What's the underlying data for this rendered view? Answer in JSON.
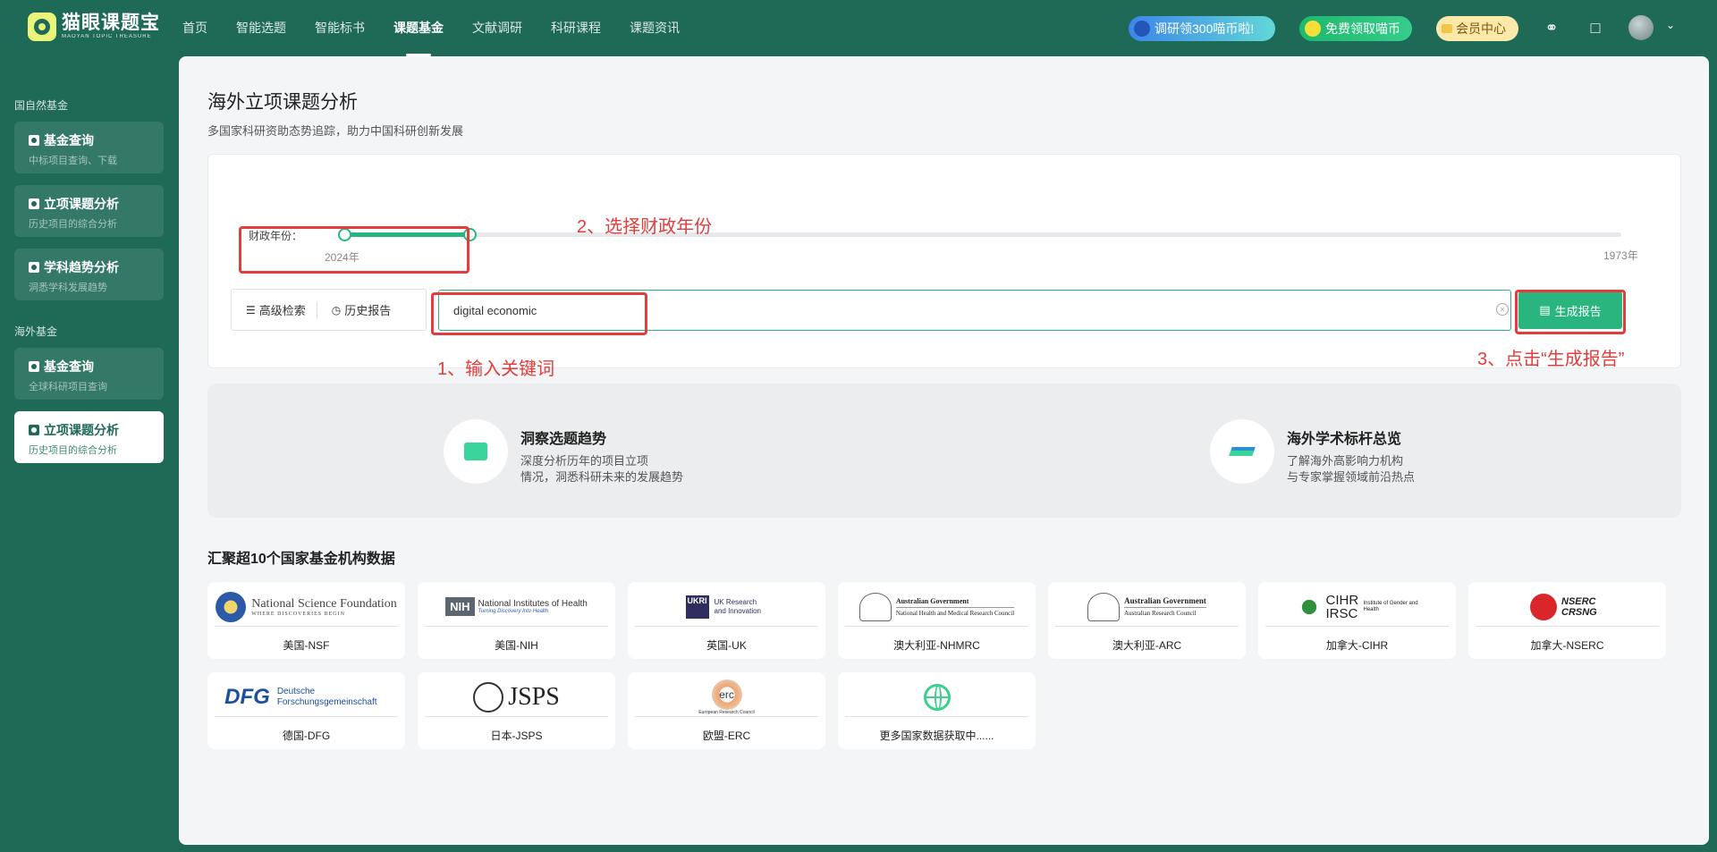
{
  "app": {
    "logo_cn": "猫眼课题宝",
    "logo_en": "MAOYAN TOPIC TREASURE"
  },
  "nav": {
    "items": [
      "首页",
      "智能选题",
      "智能标书",
      "课题基金",
      "文献调研",
      "科研课程",
      "课题资讯"
    ],
    "active_index": 3
  },
  "promos": {
    "p1": "调研领300喵币啦!",
    "p2": "免费领取喵币",
    "p3": "会员中心"
  },
  "sidebar": {
    "group1": "国自然基金",
    "group2": "海外基金",
    "items": [
      {
        "title": "基金查询",
        "sub": "中标项目查询、下载"
      },
      {
        "title": "立项课题分析",
        "sub": "历史项目的综合分析"
      },
      {
        "title": "学科趋势分析",
        "sub": "洞悉学科发展趋势"
      },
      {
        "title": "基金查询",
        "sub": "全球科研项目查询"
      },
      {
        "title": "立项课题分析",
        "sub": "历史项目的综合分析",
        "active": true
      }
    ]
  },
  "page": {
    "title": "海外立项课题分析",
    "subtitle": "多国家科研资助态势追踪，助力中国科研创新发展"
  },
  "filter": {
    "year_label": "财政年份：",
    "year_left": "2024年",
    "year_right": "1973年"
  },
  "toolbar": {
    "advanced": "高级检索",
    "history": "历史报告"
  },
  "search": {
    "value": "digital economic",
    "generate": "生成报告"
  },
  "annotations": {
    "a1": "1、输入关键词",
    "a2": "2、选择财政年份",
    "a3": "3、点击“生成报告”"
  },
  "features": [
    {
      "title": "洞察选题趋势",
      "line1": "深度分析历年的项目立项",
      "line2": "情况，洞悉科研未来的发展趋势"
    },
    {
      "title": "海外学术标杆总览",
      "line1": "了解海外高影响力机构",
      "line2": "与专家掌握领域前沿热点"
    }
  ],
  "institutions_title": "汇聚超10个国家基金机构数据",
  "institutions": [
    {
      "caption": "美国-NSF",
      "logo": "National Science Foundation",
      "logo_sub": "WHERE DISCOVERIES BEGIN"
    },
    {
      "caption": "美国-NIH",
      "logo": "National Institutes of Health",
      "logo_sub": "Turning Discovery Into Health",
      "badge": "NIH"
    },
    {
      "caption": "英国-UK",
      "logo": "UK Research and Innovation",
      "badge": "UKRI"
    },
    {
      "caption": "澳大利亚-NHMRC",
      "logo": "Australian Government",
      "logo_sub": "National Health and Medical Research Council"
    },
    {
      "caption": "澳大利亚-ARC",
      "logo": "Australian Government",
      "logo_sub": "Australian Research Council"
    },
    {
      "caption": "加拿大-CIHR",
      "logo": "CIHR IRSC",
      "logo_sub": "Institute of Gender and Health"
    },
    {
      "caption": "加拿大-NSERC",
      "logo": "NSERC CRSNG"
    },
    {
      "caption": "德国-DFG",
      "logo": "DFG",
      "logo_sub": "Deutsche Forschungsgemeinschaft"
    },
    {
      "caption": "日本-JSPS",
      "logo": "JSPS"
    },
    {
      "caption": "欧盟-ERC",
      "logo": "erc",
      "logo_sub": "European Research Council"
    },
    {
      "caption": "更多国家数据获取中......"
    }
  ],
  "colors": {
    "brand": "#1e6a56",
    "accent": "#2ab57f",
    "annotation": "#e23c3c"
  }
}
